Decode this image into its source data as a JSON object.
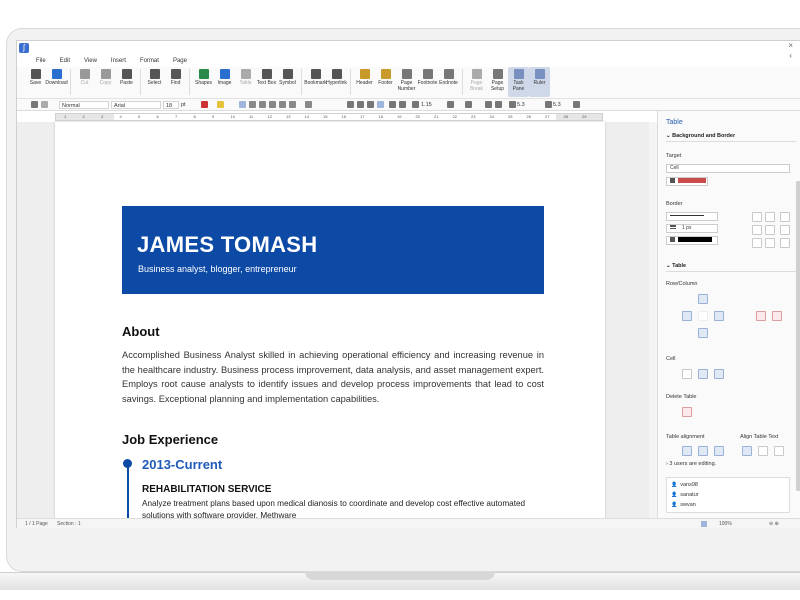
{
  "menu": [
    "File",
    "Edit",
    "View",
    "Insert",
    "Format",
    "Page"
  ],
  "window": {
    "close_label": "×",
    "collapse_label": "‹"
  },
  "toolbar": [
    {
      "label": "Save",
      "icon": "save-icon",
      "state": "normal"
    },
    {
      "label": "Download",
      "icon": "download-icon",
      "state": "normal"
    },
    {
      "label": "Cut",
      "icon": "cut-icon",
      "state": "dim"
    },
    {
      "label": "Copy",
      "icon": "copy-icon",
      "state": "dim"
    },
    {
      "label": "Paste",
      "icon": "paste-icon",
      "state": "normal"
    },
    {
      "label": "Select",
      "icon": "select-icon",
      "state": "normal"
    },
    {
      "label": "Find",
      "icon": "find-icon",
      "state": "normal"
    },
    {
      "label": "Shapes",
      "icon": "shapes-icon",
      "state": "normal"
    },
    {
      "label": "Image",
      "icon": "image-icon",
      "state": "normal"
    },
    {
      "label": "Table",
      "icon": "table-icon",
      "state": "dim"
    },
    {
      "label": "Text Box",
      "icon": "textbox-icon",
      "state": "normal"
    },
    {
      "label": "Symbol",
      "icon": "symbol-icon",
      "state": "normal"
    },
    {
      "label": "Bookmark",
      "icon": "bookmark-icon",
      "state": "normal"
    },
    {
      "label": "Hyperlink",
      "icon": "hyperlink-icon",
      "state": "normal"
    },
    {
      "label": "Header",
      "icon": "header-icon",
      "state": "normal"
    },
    {
      "label": "Footer",
      "icon": "footer-icon",
      "state": "normal"
    },
    {
      "label": "Page Number",
      "icon": "page-number-icon",
      "state": "normal"
    },
    {
      "label": "Footnote",
      "icon": "footnote-icon",
      "state": "normal"
    },
    {
      "label": "Endnote",
      "icon": "endnote-icon",
      "state": "normal"
    },
    {
      "label": "Page Break",
      "icon": "page-break-icon",
      "state": "dim"
    },
    {
      "label": "Page Setup",
      "icon": "page-setup-icon",
      "state": "normal"
    },
    {
      "label": "Task Pane",
      "icon": "task-pane-icon",
      "state": "active"
    },
    {
      "label": "Ruler",
      "icon": "ruler-icon",
      "state": "active"
    }
  ],
  "format": {
    "style": "Normal",
    "font": "Arial",
    "size": "18",
    "size_unit": "pt",
    "line_spacing": "1.15",
    "spacing_before": "5.3",
    "spacing_after": "5.3"
  },
  "ruler_ticks": [
    "1",
    "2",
    "3",
    "4",
    "5",
    "6",
    "7",
    "8",
    "9",
    "10",
    "11",
    "12",
    "13",
    "14",
    "15",
    "16",
    "17",
    "18",
    "19",
    "20",
    "21",
    "22",
    "23",
    "24",
    "25",
    "26",
    "27",
    "28",
    "29"
  ],
  "document": {
    "name": "JAMES TOMASH",
    "subtitle": "Business analyst, blogger, entrepreneur",
    "about_heading": "About",
    "about_text": "Accomplished Business Analyst skilled in achieving operational efficiency and increasing revenue in the healthcare industry. Business process improvement, data analysis, and asset management expert. Employs root cause analysts to identify issues and develop process improvements that lead to cost savings. Exceptional planning and implementation capabilities.",
    "job_heading": "Job Experience",
    "job_period": "2013-Current",
    "job_title": "REHABILITATION SERVICE",
    "job_desc": "Analyze treatment plans based upon medical dianosis to coordinate and develop cost effective automated solutions with software provider. Methware"
  },
  "status": {
    "page": "1 / 1 Page",
    "section": "Section : 1",
    "zoom": "100%"
  },
  "pane": {
    "title": "Table",
    "bg_section": "Background and Border",
    "target_label": "Target",
    "target_value": "Cell",
    "fill_color": "#c94a4a",
    "border_label": "Border",
    "border_width": "1 px",
    "border_color": "#000000",
    "table_section": "Table",
    "rowcol_label": "Row/Column",
    "cell_label": "Cell",
    "delete_label": "Delete Table",
    "align_label": "Table alignment",
    "align_text_label": "Align Table Text",
    "editing_note": "3 users are editing.",
    "users": [
      "vans98",
      "sanatur",
      "swvan"
    ]
  },
  "colors": {
    "accent": "#0c4aa6",
    "pane_title": "#2a5db0",
    "active_tool": "#cfd8e8"
  }
}
